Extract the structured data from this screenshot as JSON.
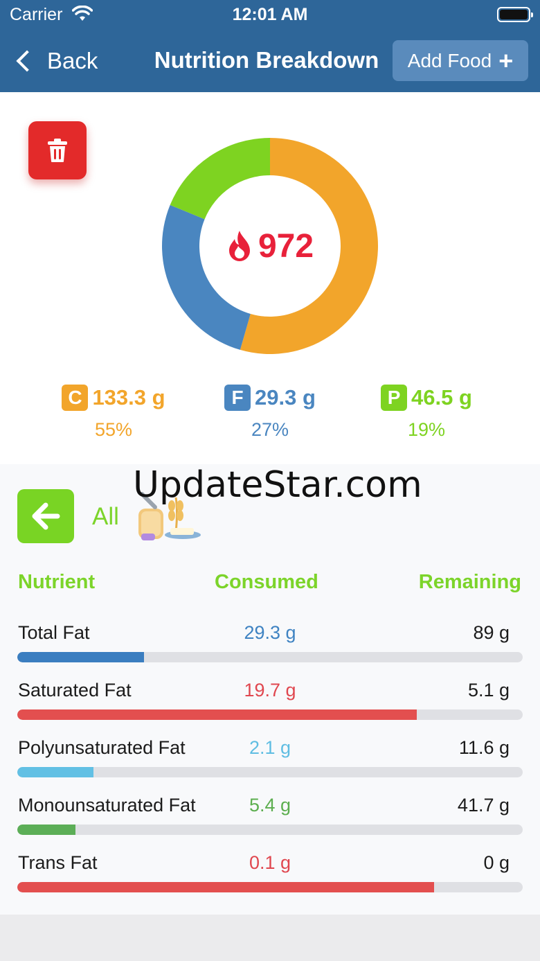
{
  "status_bar": {
    "carrier": "Carrier",
    "time": "12:01 AM"
  },
  "nav": {
    "back_label": "Back",
    "title": "Nutrition Breakdown",
    "add_food_label": "Add Food"
  },
  "summary": {
    "calories": "972",
    "macros": [
      {
        "letter": "C",
        "grams": "133.3 g",
        "percent": "55%",
        "color": "#f2a52b"
      },
      {
        "letter": "F",
        "grams": "29.3 g",
        "percent": "27%",
        "color": "#4a86c0"
      },
      {
        "letter": "P",
        "grams": "46.5 g",
        "percent": "19%",
        "color": "#7ed321"
      }
    ],
    "donut_fractions": [
      0.55,
      0.27,
      0.19
    ]
  },
  "filter": {
    "label": "All"
  },
  "watermark": "UpdateStar.com",
  "table": {
    "headers": {
      "nutrient": "Nutrient",
      "consumed": "Consumed",
      "remaining": "Remaining"
    },
    "rows": [
      {
        "name": "Total Fat",
        "consumed": "29.3 g",
        "remaining": "89 g",
        "color": "#3b7ec0",
        "consumed_color": "#3f83c2",
        "progress": 0.25
      },
      {
        "name": "Saturated Fat",
        "consumed": "19.7 g",
        "remaining": "5.1 g",
        "color": "#e34f4f",
        "consumed_color": "#e0474f",
        "progress": 0.79
      },
      {
        "name": "Polyunsaturated Fat",
        "consumed": "2.1 g",
        "remaining": "11.6 g",
        "color": "#62c0e4",
        "consumed_color": "#5fbde2",
        "progress": 0.15
      },
      {
        "name": "Monounsaturated Fat",
        "consumed": "5.4 g",
        "remaining": "41.7 g",
        "color": "#5cae57",
        "consumed_color": "#5cae4f",
        "progress": 0.115
      },
      {
        "name": "Trans Fat",
        "consumed": "0.1 g",
        "remaining": "0 g",
        "color": "#e34f4f",
        "consumed_color": "#e0474f",
        "progress": 0.825
      }
    ]
  }
}
